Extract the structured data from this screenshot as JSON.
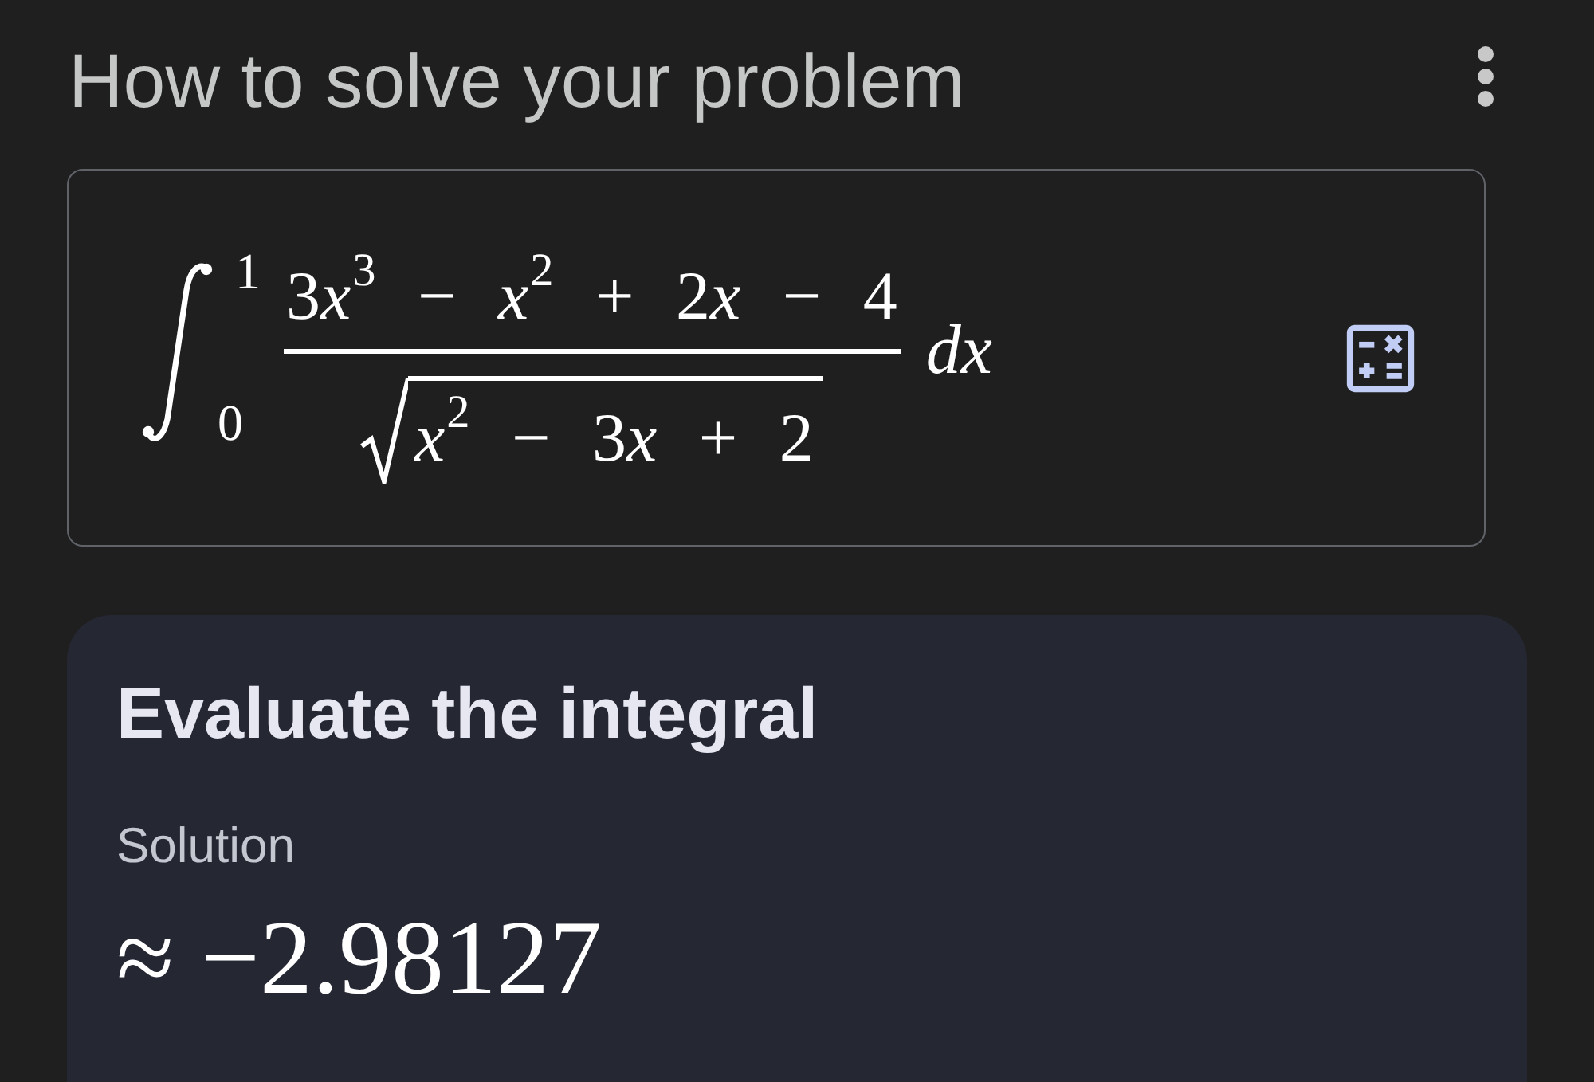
{
  "header": {
    "title": "How to solve your problem"
  },
  "problem": {
    "integral": {
      "upper_limit": "1",
      "lower_limit": "0",
      "numerator": "3⁠*x*$^{3}$ − *x*$^{2}$ + 2⁠*x* − 4",
      "radicand": "*x*$^{2}$ − 3⁠*x* + 2",
      "differential": "dx"
    }
  },
  "result_card": {
    "title": "Evaluate the integral",
    "label": "Solution",
    "value": "≈ −2.98127"
  }
}
